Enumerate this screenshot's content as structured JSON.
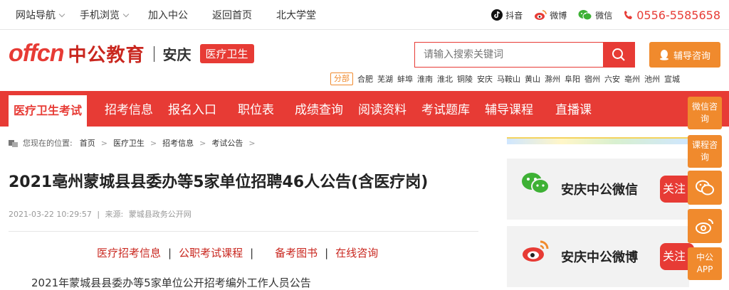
{
  "topnav": {
    "items": [
      "网站导航",
      "手机浏览",
      "加入中公",
      "返回首页",
      "北大学堂"
    ]
  },
  "topright": {
    "douyin": "抖音",
    "weibo": "微博",
    "wechat": "微信",
    "phone": "0556-5585658"
  },
  "header": {
    "logo_mark": "offcn",
    "logo_text": "中公教育",
    "city": "安庆",
    "channel_tag": "医疗卫生",
    "search_placeholder": "请输入搜索关键词",
    "counsel_label": "辅导咨询",
    "branch_label": "分部",
    "branches": [
      "合肥",
      "芜湖",
      "蚌埠",
      "淮南",
      "淮北",
      "铜陵",
      "安庆",
      "马鞍山",
      "黄山",
      "滁州",
      "阜阳",
      "宿州",
      "六安",
      "亳州",
      "池州",
      "宣城"
    ]
  },
  "mainnav": {
    "items": [
      "医疗卫生考试",
      "招考信息",
      "报名入口",
      "职位表",
      "成绩查询",
      "阅读资料",
      "考试题库",
      "辅导课程",
      "直播课"
    ]
  },
  "breadcrumb": {
    "prefix": "您现在的位置:",
    "items": [
      "首页",
      "医疗卫生",
      "招考信息",
      "考试公告"
    ]
  },
  "article": {
    "title": "2021亳州蒙城县县委办等5家单位招聘46人公告(含医疗岗)",
    "datetime": "2021-03-22 10:29:57",
    "source_label": "来源:",
    "source": "蒙城县政务公开网",
    "links": [
      "医疗招考信息",
      "公职考试课程",
      "备考图书",
      "在线咨询"
    ],
    "first_line": "2021年蒙城县县委办等5家单位公开招考编外工作人员公告"
  },
  "sidebar": {
    "wechat_card": "安庆中公微信",
    "weibo_card": "安庆中公微博",
    "follow_label": "关注"
  },
  "floatbar": {
    "items": [
      "微信咨询",
      "课程咨询",
      "中公APP"
    ]
  },
  "colors": {
    "brand_red": "#e73b35",
    "accent_orange": "#f08a2d"
  }
}
